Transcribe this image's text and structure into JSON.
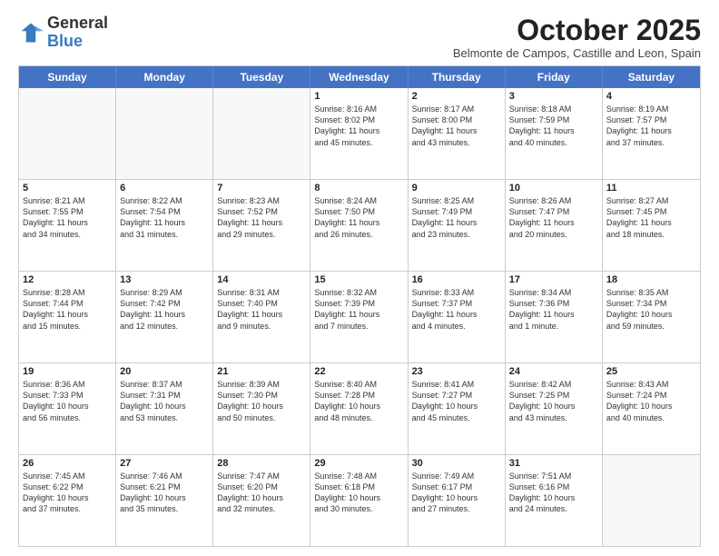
{
  "logo": {
    "general": "General",
    "blue": "Blue"
  },
  "title": "October 2025",
  "subtitle": "Belmonte de Campos, Castille and Leon, Spain",
  "headers": [
    "Sunday",
    "Monday",
    "Tuesday",
    "Wednesday",
    "Thursday",
    "Friday",
    "Saturday"
  ],
  "rows": [
    [
      {
        "day": "",
        "text": ""
      },
      {
        "day": "",
        "text": ""
      },
      {
        "day": "",
        "text": ""
      },
      {
        "day": "1",
        "text": "Sunrise: 8:16 AM\nSunset: 8:02 PM\nDaylight: 11 hours\nand 45 minutes."
      },
      {
        "day": "2",
        "text": "Sunrise: 8:17 AM\nSunset: 8:00 PM\nDaylight: 11 hours\nand 43 minutes."
      },
      {
        "day": "3",
        "text": "Sunrise: 8:18 AM\nSunset: 7:59 PM\nDaylight: 11 hours\nand 40 minutes."
      },
      {
        "day": "4",
        "text": "Sunrise: 8:19 AM\nSunset: 7:57 PM\nDaylight: 11 hours\nand 37 minutes."
      }
    ],
    [
      {
        "day": "5",
        "text": "Sunrise: 8:21 AM\nSunset: 7:55 PM\nDaylight: 11 hours\nand 34 minutes."
      },
      {
        "day": "6",
        "text": "Sunrise: 8:22 AM\nSunset: 7:54 PM\nDaylight: 11 hours\nand 31 minutes."
      },
      {
        "day": "7",
        "text": "Sunrise: 8:23 AM\nSunset: 7:52 PM\nDaylight: 11 hours\nand 29 minutes."
      },
      {
        "day": "8",
        "text": "Sunrise: 8:24 AM\nSunset: 7:50 PM\nDaylight: 11 hours\nand 26 minutes."
      },
      {
        "day": "9",
        "text": "Sunrise: 8:25 AM\nSunset: 7:49 PM\nDaylight: 11 hours\nand 23 minutes."
      },
      {
        "day": "10",
        "text": "Sunrise: 8:26 AM\nSunset: 7:47 PM\nDaylight: 11 hours\nand 20 minutes."
      },
      {
        "day": "11",
        "text": "Sunrise: 8:27 AM\nSunset: 7:45 PM\nDaylight: 11 hours\nand 18 minutes."
      }
    ],
    [
      {
        "day": "12",
        "text": "Sunrise: 8:28 AM\nSunset: 7:44 PM\nDaylight: 11 hours\nand 15 minutes."
      },
      {
        "day": "13",
        "text": "Sunrise: 8:29 AM\nSunset: 7:42 PM\nDaylight: 11 hours\nand 12 minutes."
      },
      {
        "day": "14",
        "text": "Sunrise: 8:31 AM\nSunset: 7:40 PM\nDaylight: 11 hours\nand 9 minutes."
      },
      {
        "day": "15",
        "text": "Sunrise: 8:32 AM\nSunset: 7:39 PM\nDaylight: 11 hours\nand 7 minutes."
      },
      {
        "day": "16",
        "text": "Sunrise: 8:33 AM\nSunset: 7:37 PM\nDaylight: 11 hours\nand 4 minutes."
      },
      {
        "day": "17",
        "text": "Sunrise: 8:34 AM\nSunset: 7:36 PM\nDaylight: 11 hours\nand 1 minute."
      },
      {
        "day": "18",
        "text": "Sunrise: 8:35 AM\nSunset: 7:34 PM\nDaylight: 10 hours\nand 59 minutes."
      }
    ],
    [
      {
        "day": "19",
        "text": "Sunrise: 8:36 AM\nSunset: 7:33 PM\nDaylight: 10 hours\nand 56 minutes."
      },
      {
        "day": "20",
        "text": "Sunrise: 8:37 AM\nSunset: 7:31 PM\nDaylight: 10 hours\nand 53 minutes."
      },
      {
        "day": "21",
        "text": "Sunrise: 8:39 AM\nSunset: 7:30 PM\nDaylight: 10 hours\nand 50 minutes."
      },
      {
        "day": "22",
        "text": "Sunrise: 8:40 AM\nSunset: 7:28 PM\nDaylight: 10 hours\nand 48 minutes."
      },
      {
        "day": "23",
        "text": "Sunrise: 8:41 AM\nSunset: 7:27 PM\nDaylight: 10 hours\nand 45 minutes."
      },
      {
        "day": "24",
        "text": "Sunrise: 8:42 AM\nSunset: 7:25 PM\nDaylight: 10 hours\nand 43 minutes."
      },
      {
        "day": "25",
        "text": "Sunrise: 8:43 AM\nSunset: 7:24 PM\nDaylight: 10 hours\nand 40 minutes."
      }
    ],
    [
      {
        "day": "26",
        "text": "Sunrise: 7:45 AM\nSunset: 6:22 PM\nDaylight: 10 hours\nand 37 minutes."
      },
      {
        "day": "27",
        "text": "Sunrise: 7:46 AM\nSunset: 6:21 PM\nDaylight: 10 hours\nand 35 minutes."
      },
      {
        "day": "28",
        "text": "Sunrise: 7:47 AM\nSunset: 6:20 PM\nDaylight: 10 hours\nand 32 minutes."
      },
      {
        "day": "29",
        "text": "Sunrise: 7:48 AM\nSunset: 6:18 PM\nDaylight: 10 hours\nand 30 minutes."
      },
      {
        "day": "30",
        "text": "Sunrise: 7:49 AM\nSunset: 6:17 PM\nDaylight: 10 hours\nand 27 minutes."
      },
      {
        "day": "31",
        "text": "Sunrise: 7:51 AM\nSunset: 6:16 PM\nDaylight: 10 hours\nand 24 minutes."
      },
      {
        "day": "",
        "text": ""
      }
    ]
  ]
}
